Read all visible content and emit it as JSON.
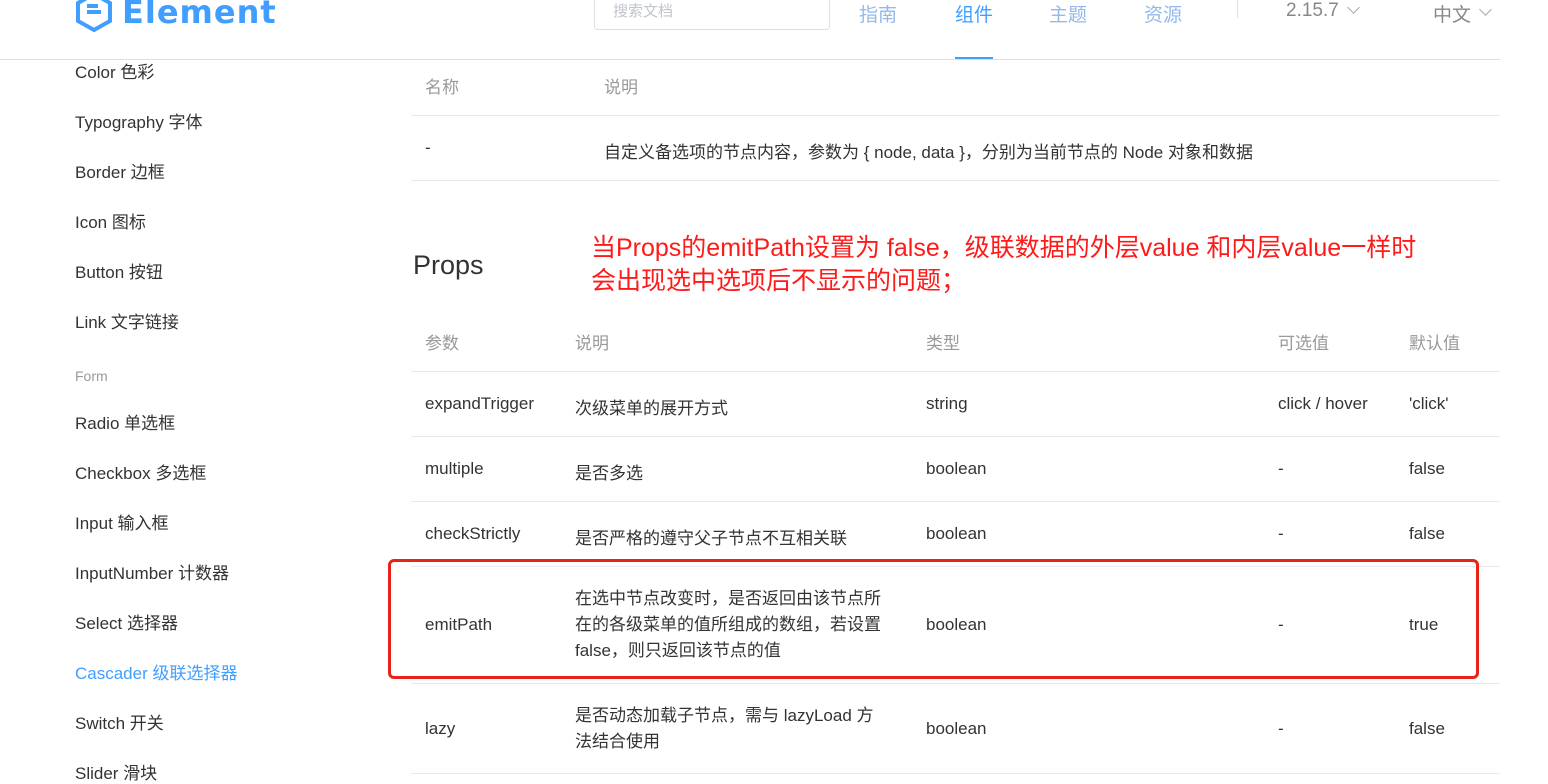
{
  "header": {
    "logo_text": "Element",
    "search_placeholder": "搜索文档",
    "nav": [
      "指南",
      "组件",
      "主题",
      "资源"
    ],
    "version": "2.15.7",
    "language": "中文",
    "accent": "#409EFF"
  },
  "sidebar": {
    "items_top": [
      "Color 色彩",
      "Typography 字体",
      "Border 边框",
      "Icon 图标",
      "Button 按钮",
      "Link 文字链接"
    ],
    "group_form": "Form",
    "items_form": [
      "Radio 单选框",
      "Checkbox 多选框",
      "Input 输入框",
      "InputNumber 计数器",
      "Select 选择器",
      "Cascader 级联选择器",
      "Switch 开关",
      "Slider 滑块"
    ],
    "active": "Cascader 级联选择器"
  },
  "slot_table": {
    "headers": [
      "名称",
      "说明"
    ],
    "rows": [
      [
        "-",
        "自定义备选项的节点内容，参数为 { node, data }，分别为当前节点的 Node 对象和数据"
      ]
    ]
  },
  "props_title": "Props",
  "annotation": [
    "当Props的emitPath设置为 false，级联数据的外层value 和内层value一样时",
    "会出现选中选项后不显示的问题；"
  ],
  "props_table": {
    "headers": [
      "参数",
      "说明",
      "类型",
      "可选值",
      "默认值"
    ],
    "rows": [
      [
        "expandTrigger",
        "次级菜单的展开方式",
        "string",
        "click / hover",
        "'click'"
      ],
      [
        "multiple",
        "是否多选",
        "boolean",
        "-",
        "false"
      ],
      [
        "checkStrictly",
        "是否严格的遵守父子节点不互相关联",
        "boolean",
        "-",
        "false"
      ],
      [
        "emitPath",
        "在选中节点改变时，是否返回由该节点所在的各级菜单的值所组成的数组，若设置 false，则只返回该节点的值",
        "boolean",
        "-",
        "true"
      ],
      [
        "lazy",
        "是否动态加载子节点，需与 lazyLoad 方法结合使用",
        "boolean",
        "-",
        "false"
      ]
    ]
  }
}
